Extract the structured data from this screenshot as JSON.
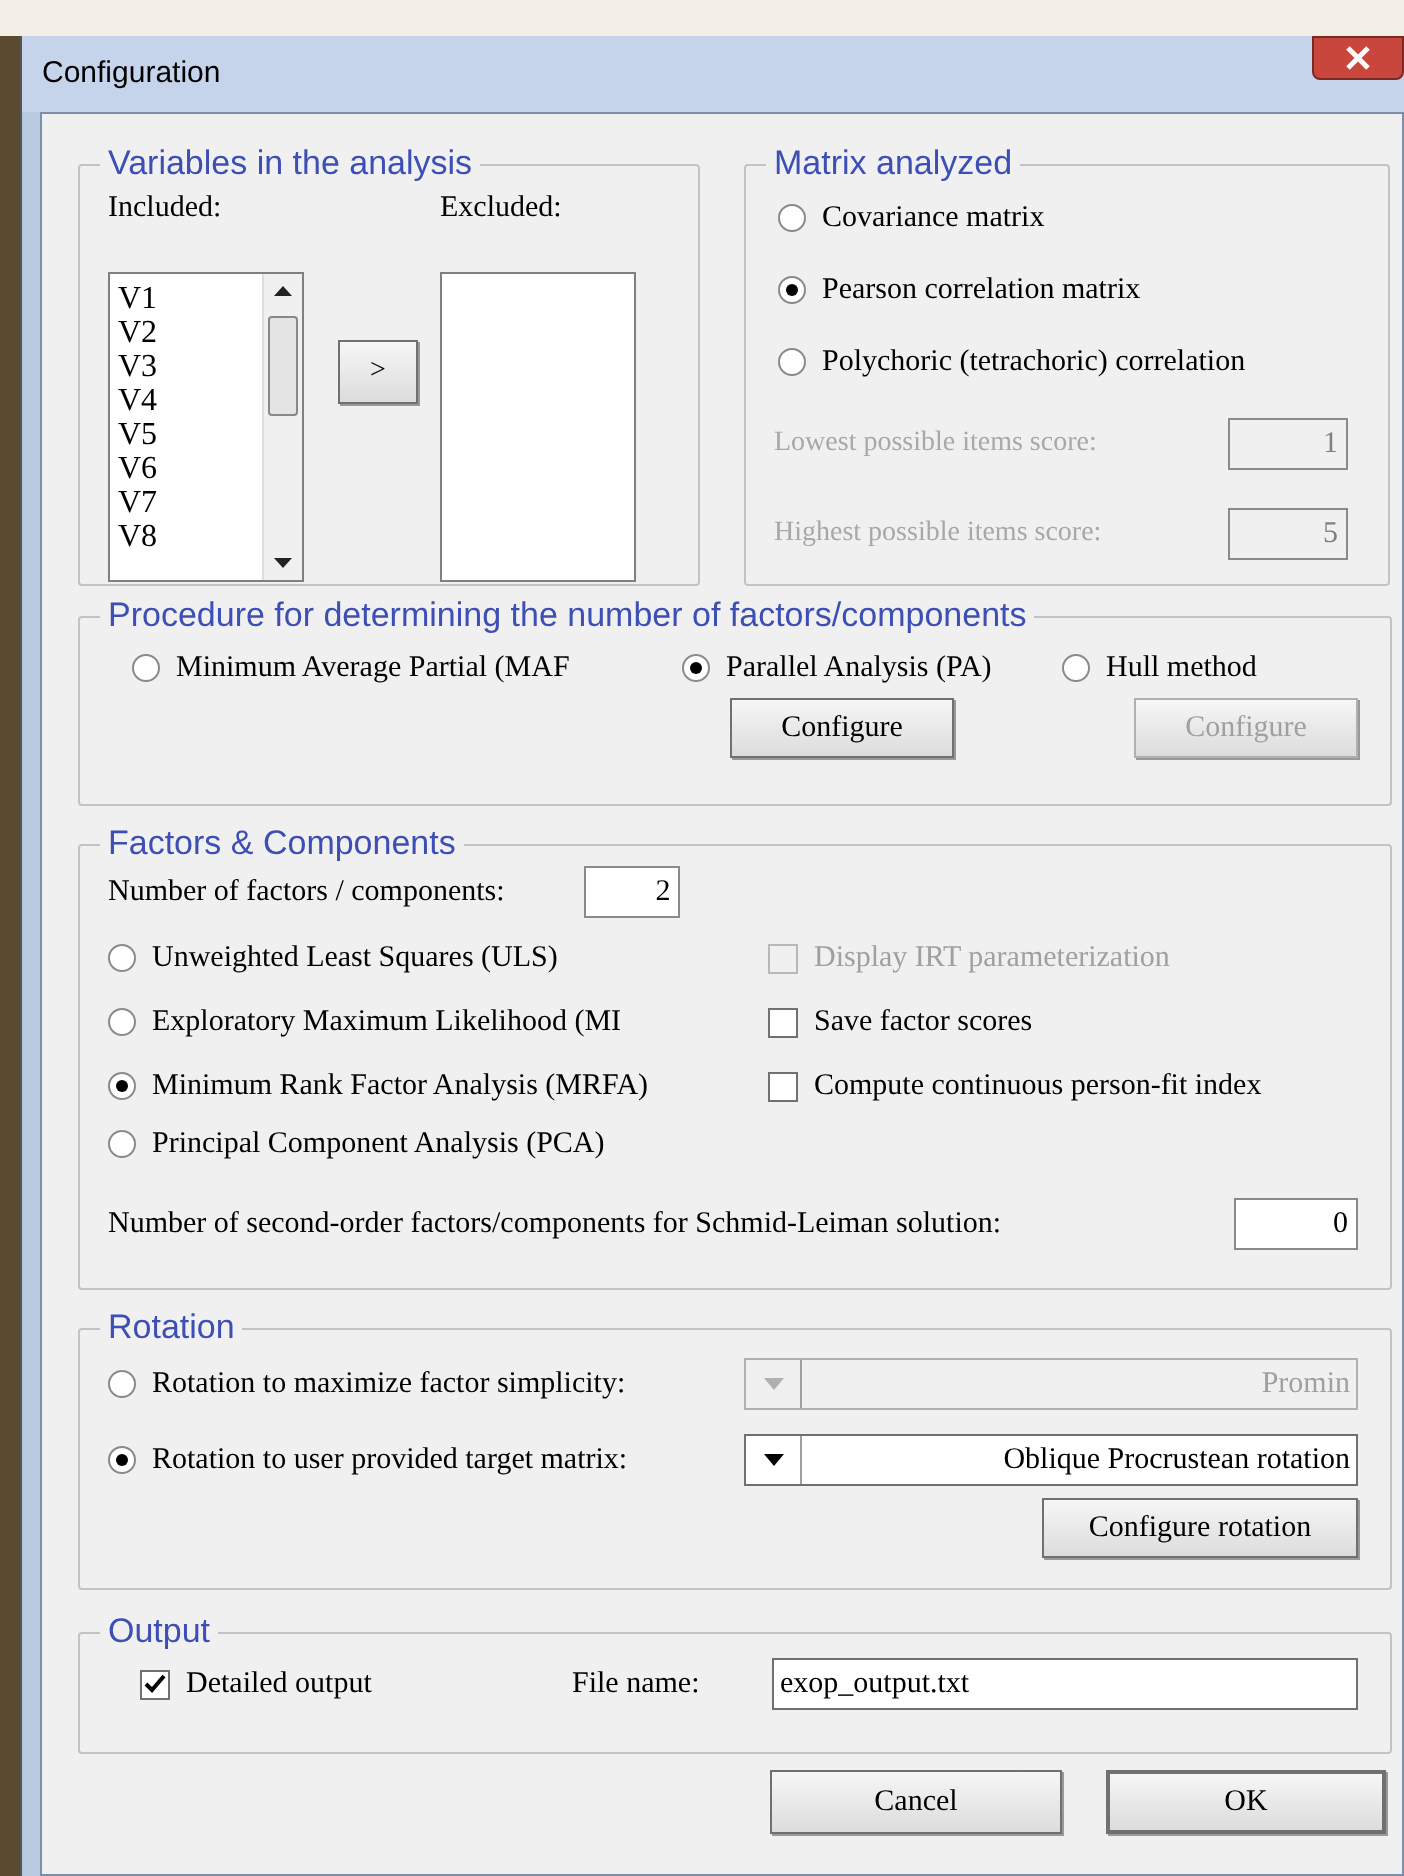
{
  "window": {
    "title": "Configuration"
  },
  "variables": {
    "title": "Variables in the analysis",
    "included_label": "Included:",
    "excluded_label": "Excluded:",
    "included_items": [
      "V1",
      "V2",
      "V3",
      "V4",
      "V5",
      "V6",
      "V7",
      "V8"
    ],
    "move_button": ">"
  },
  "matrix": {
    "title": "Matrix analyzed",
    "options": [
      {
        "label": "Covariance matrix",
        "selected": false
      },
      {
        "label": "Pearson correlation matrix",
        "selected": true
      },
      {
        "label": "Polychoric (tetrachoric) correlation",
        "selected": false
      }
    ],
    "scores": [
      {
        "label": "Lowest possible items score:",
        "value": "1",
        "disabled": true
      },
      {
        "label": "Highest possible items score:",
        "value": "5",
        "disabled": true
      }
    ]
  },
  "procedure": {
    "title": "Procedure for determining the number of factors/components",
    "options": [
      {
        "label": "Minimum Average Partial (MAF",
        "selected": false
      },
      {
        "label": "Parallel Analysis (PA)",
        "selected": true
      },
      {
        "label": "Hull method",
        "selected": false
      }
    ],
    "configure_buttons": [
      {
        "label": "Configure",
        "disabled": false
      },
      {
        "label": "Configure",
        "disabled": true
      }
    ]
  },
  "factors": {
    "title": "Factors & Components",
    "count_label": "Number of factors / components:",
    "count_value": "2",
    "methods": [
      {
        "label": "Unweighted Least Squares (ULS)",
        "selected": false
      },
      {
        "label": "Exploratory Maximum Likelihood (MI",
        "selected": false
      },
      {
        "label": "Minimum Rank Factor Analysis (MRFA)",
        "selected": true
      },
      {
        "label": "Principal Component Analysis (PCA)",
        "selected": false
      }
    ],
    "checkboxes": [
      {
        "label": "Display IRT parameterization",
        "checked": false,
        "disabled": true
      },
      {
        "label": "Save factor scores",
        "checked": false,
        "disabled": false
      },
      {
        "label": "Compute continuous person-fit index",
        "checked": false,
        "disabled": false
      }
    ],
    "second_order_label": "Number of second-order factors/components for Schmid-Leiman solution:",
    "second_order_value": "0"
  },
  "rotation": {
    "title": "Rotation",
    "options": [
      {
        "label": "Rotation to maximize factor simplicity:",
        "selected": false,
        "dropdown": "Promin",
        "disabled": true
      },
      {
        "label": "Rotation to user provided target matrix:",
        "selected": true,
        "dropdown": "Oblique Procrustean rotation",
        "disabled": false
      }
    ],
    "configure_button": "Configure rotation"
  },
  "output": {
    "title": "Output",
    "detailed": {
      "label": "Detailed output",
      "checked": true
    },
    "file_label": "File name:",
    "file_value": "exop_output.txt"
  },
  "buttons": [
    {
      "label": "Cancel",
      "default": false
    },
    {
      "label": "OK",
      "default": true
    }
  ]
}
